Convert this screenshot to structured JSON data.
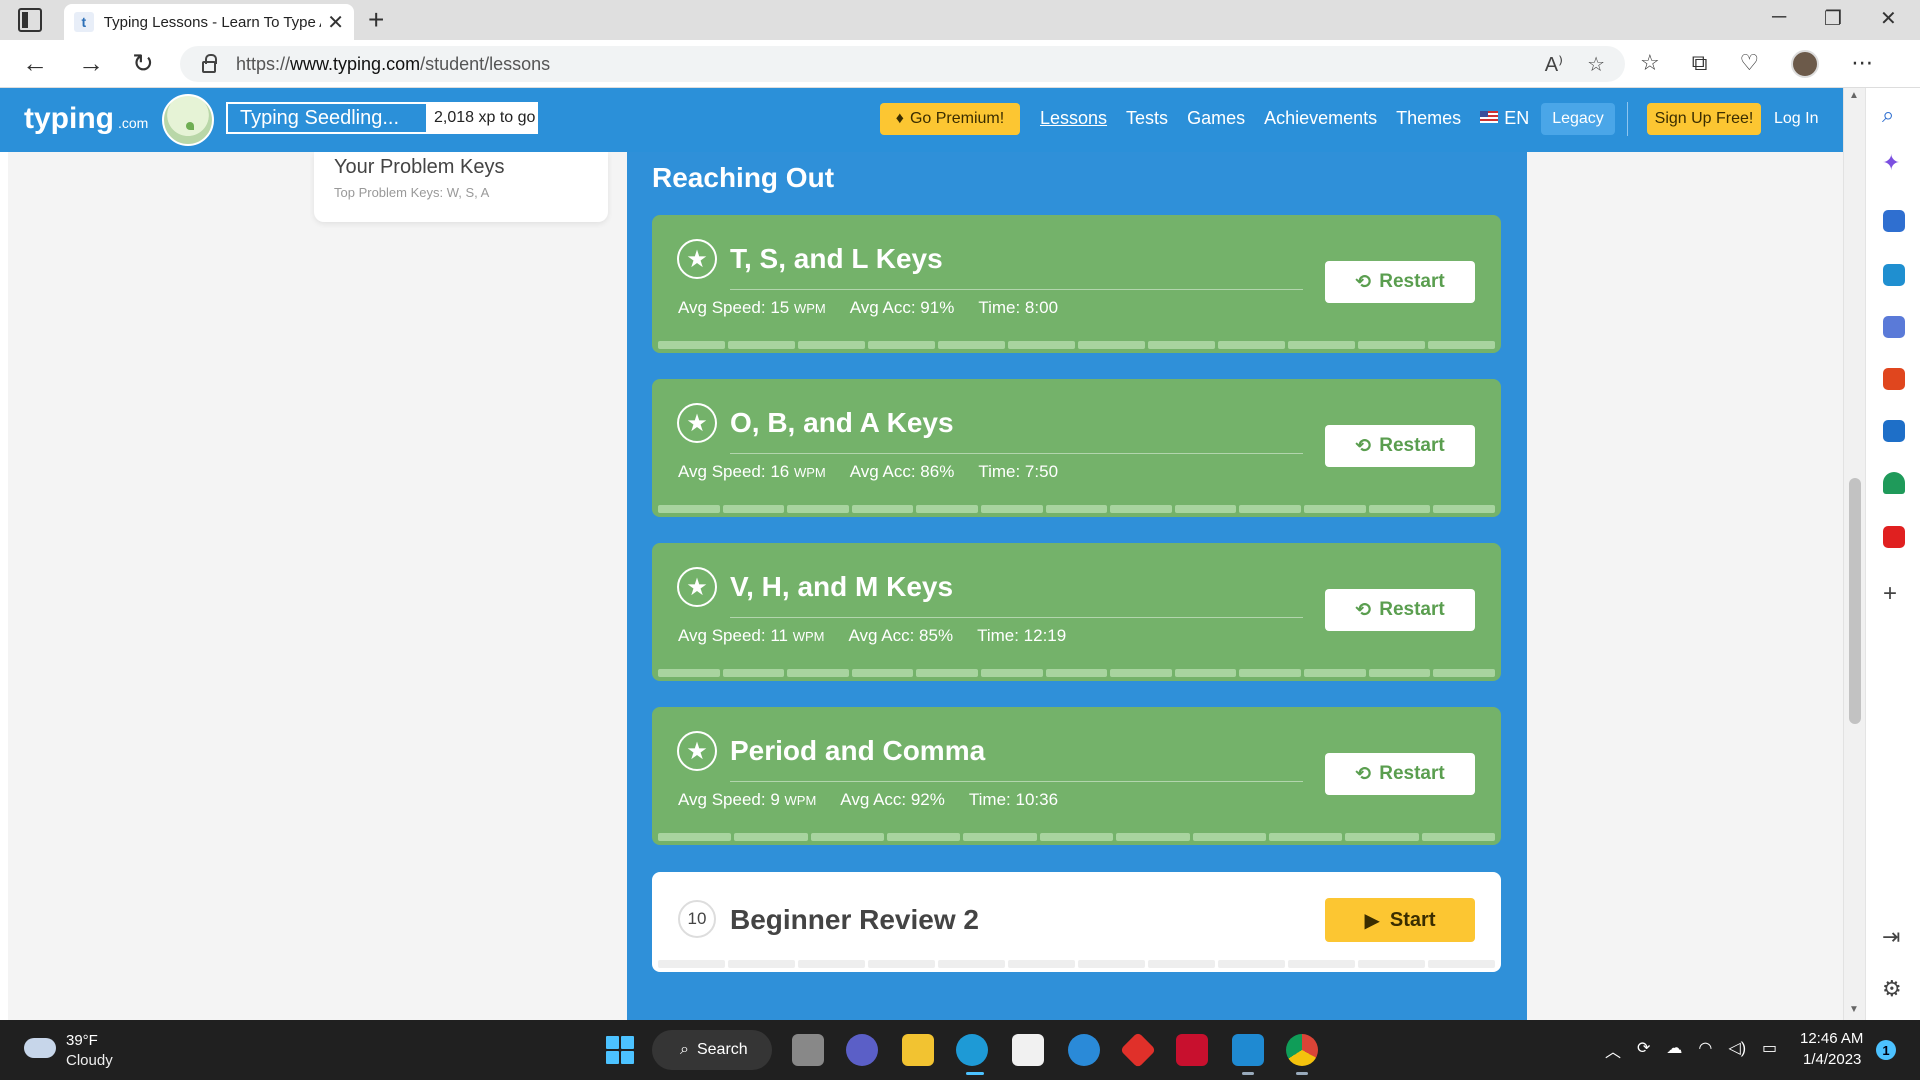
{
  "browser": {
    "tab_title": "Typing Lessons - Learn To Type A",
    "tab_favicon": "t",
    "url_prefix": "https://",
    "url_host": "www.typing.com",
    "url_path": "/student/lessons"
  },
  "site": {
    "logo": "typing",
    "logo_suffix": ".com",
    "level_name": "Typing Seedling...",
    "level_xp": "2,018 xp to go",
    "premium_label": "Go Premium!",
    "nav": [
      "Lessons",
      "Tests",
      "Games",
      "Achievements",
      "Themes",
      "EN"
    ],
    "legacy_label": "Legacy",
    "signup_label": "Sign Up Free!",
    "login_label": "Log In"
  },
  "problem_keys": {
    "title": "Your Problem Keys",
    "subtitle": "Top Problem Keys: W, S, A"
  },
  "section_title": "Reaching Out",
  "lessons": [
    {
      "title": "T, S, and L Keys",
      "speed_label": "Avg Speed: 15",
      "unit": "WPM",
      "acc": "Avg Acc: 91%",
      "time": "Time: 8:00",
      "button": "Restart"
    },
    {
      "title": "O, B, and A Keys",
      "speed_label": "Avg Speed: 16",
      "unit": "WPM",
      "acc": "Avg Acc: 86%",
      "time": "Time: 7:50",
      "button": "Restart"
    },
    {
      "title": "V, H, and M Keys",
      "speed_label": "Avg Speed: 11",
      "unit": "WPM",
      "acc": "Avg Acc: 85%",
      "time": "Time: 12:19",
      "button": "Restart"
    },
    {
      "title": "Period and Comma",
      "speed_label": "Avg Speed: 9",
      "unit": "WPM",
      "acc": "Avg Acc: 92%",
      "time": "Time: 10:36",
      "button": "Restart"
    }
  ],
  "review": {
    "number": "10",
    "title": "Beginner Review 2",
    "button": "Start"
  },
  "taskbar": {
    "temp": "39°F",
    "weather": "Cloudy",
    "search": "Search",
    "time": "12:46 AM",
    "date": "1/4/2023",
    "notifications": "1"
  },
  "colors": {
    "site_blue": "#2b90d9",
    "lesson_green": "#74b26a",
    "accent_yellow": "#fcc632"
  }
}
